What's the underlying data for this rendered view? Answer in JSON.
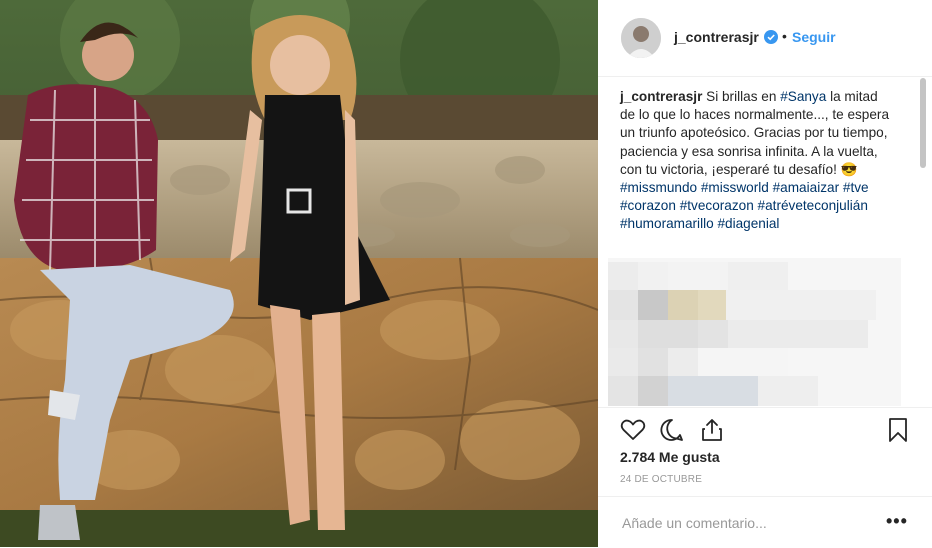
{
  "post": {
    "username": "j_contrerasjr",
    "follow_label": "Seguir",
    "separator": "•",
    "caption_user": "j_contrerasjr",
    "caption_parts": [
      {
        "text": " Si brillas en ",
        "type": "text"
      },
      {
        "text": "#Sanya",
        "type": "tag"
      },
      {
        "text": " la mitad de lo que lo haces normalmente..., te espera un triunfo apoteósico. Gracias por tu tiempo, paciencia y esa sonrisa infinita. A la vuelta, con tu victoria, ¡esperaré tu desafío! 😎",
        "type": "text"
      }
    ],
    "hashtags": [
      "#missmundo",
      "#missworld",
      "#amaiaizar",
      "#tve",
      "#corazon",
      "#tvecorazon",
      "#atrévetecon​julián",
      "#humoramarillo",
      "#diagenial"
    ],
    "likes": "2.784 Me gusta",
    "date": "24 DE OCTUBRE",
    "comment_placeholder": "Añade un comentario...",
    "more_label": "•••"
  },
  "icons": {
    "like": "heart-icon",
    "comment": "comment-icon",
    "share": "share-icon",
    "save": "bookmark-icon",
    "verified": "verified-badge-icon"
  },
  "colors": {
    "link_blue": "#3897f0",
    "hashtag": "#003569",
    "verified": "#3897f0",
    "text": "#262626",
    "muted": "#999999"
  }
}
